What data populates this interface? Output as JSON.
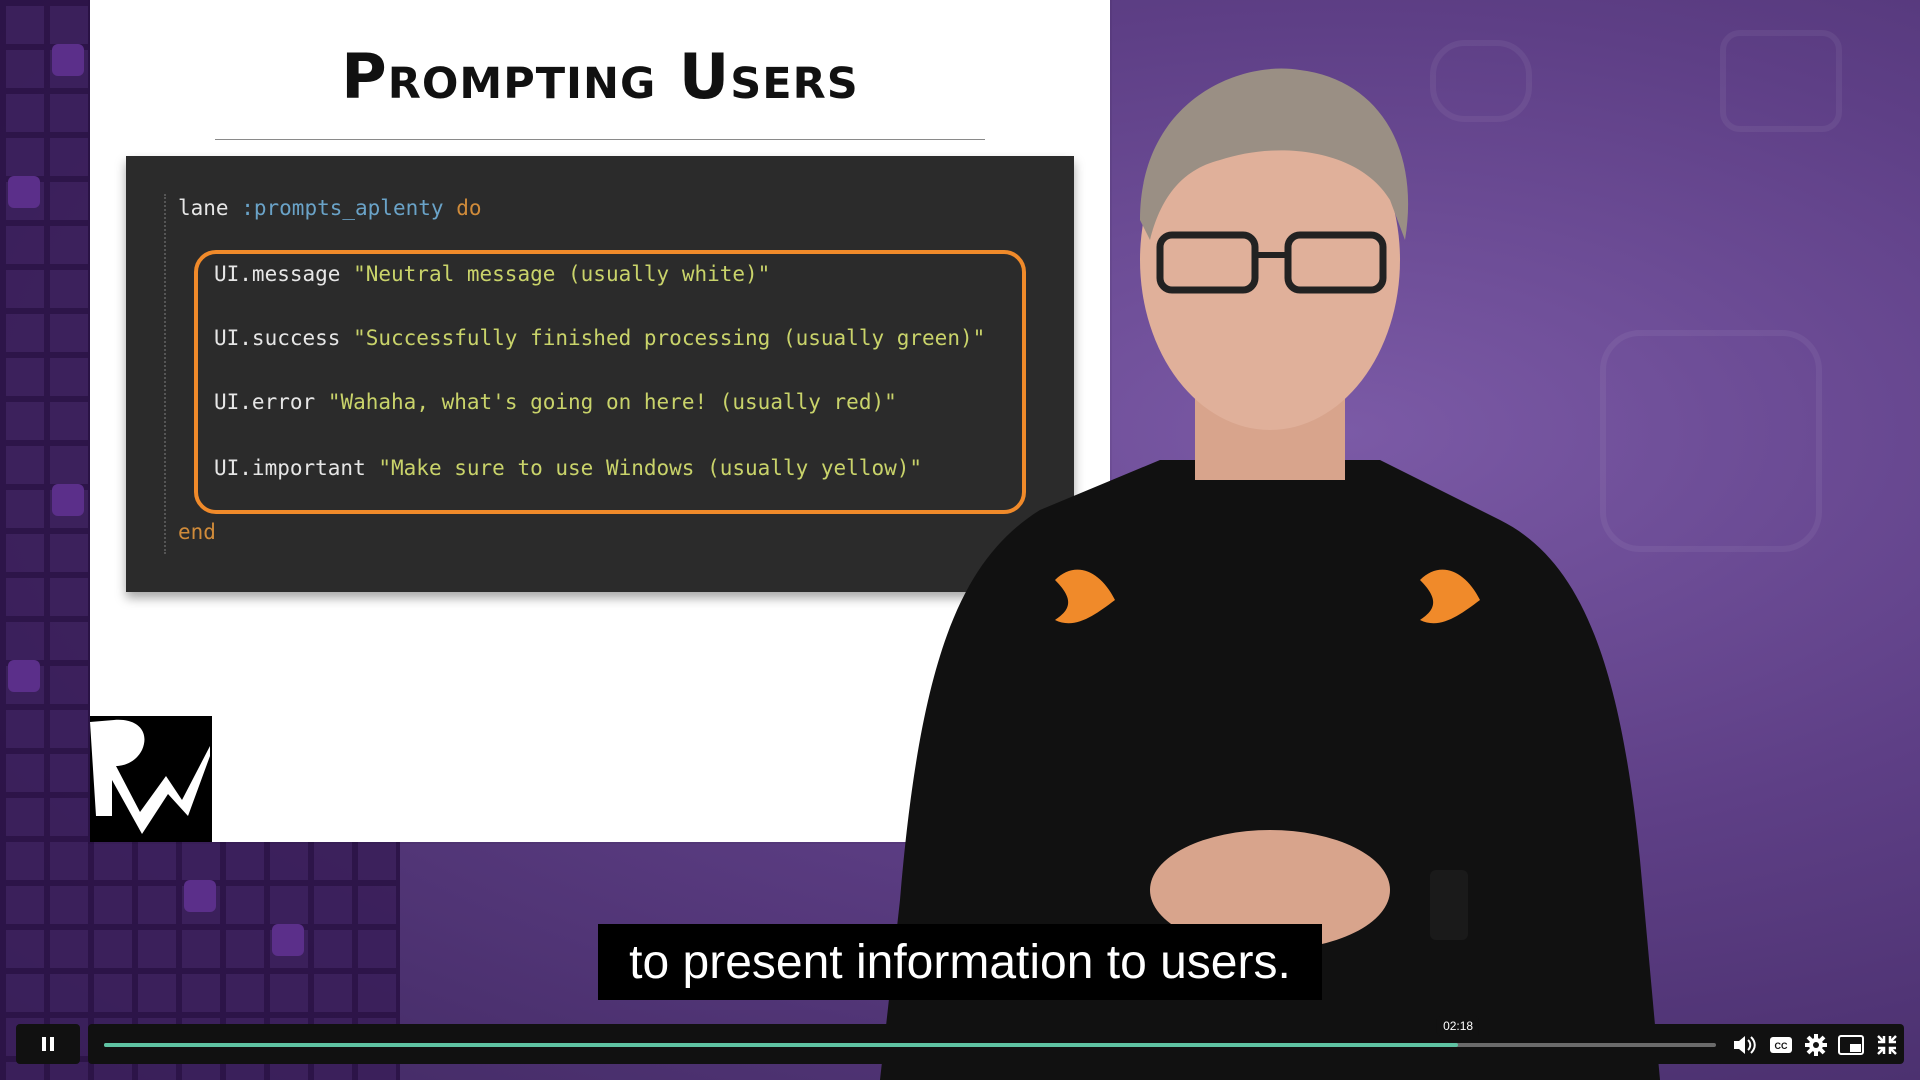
{
  "slide": {
    "title": "Prompting Users",
    "code": {
      "line1": {
        "kw1": "lane",
        "sym": ":prompts_aplenty",
        "kw2": "do"
      },
      "line2": {
        "call": "UI.message",
        "str": "\"Neutral message (usually white)\""
      },
      "line3": {
        "call": "UI.success",
        "str": "\"Successfully finished processing (usually green)\""
      },
      "line4": {
        "call": "UI.error",
        "str": "\"Wahaha, what's going on here! (usually red)\""
      },
      "line5": {
        "call": "UI.important",
        "str": "\"Make sure to use Windows (usually yellow)\""
      },
      "line6": {
        "kw": "end"
      }
    }
  },
  "caption": "to present information to users.",
  "player": {
    "current_time": "02:18",
    "progress": 0.84,
    "icons": [
      "pause-icon",
      "volume-icon",
      "captions-icon",
      "settings-icon",
      "picture-in-picture-icon",
      "exit-fullscreen-icon"
    ],
    "captions_label": "CC"
  },
  "colors": {
    "accent_orange": "#f08a2a",
    "progress_fill": "#5fc3a3",
    "code_bg": "#2b2b2b"
  }
}
